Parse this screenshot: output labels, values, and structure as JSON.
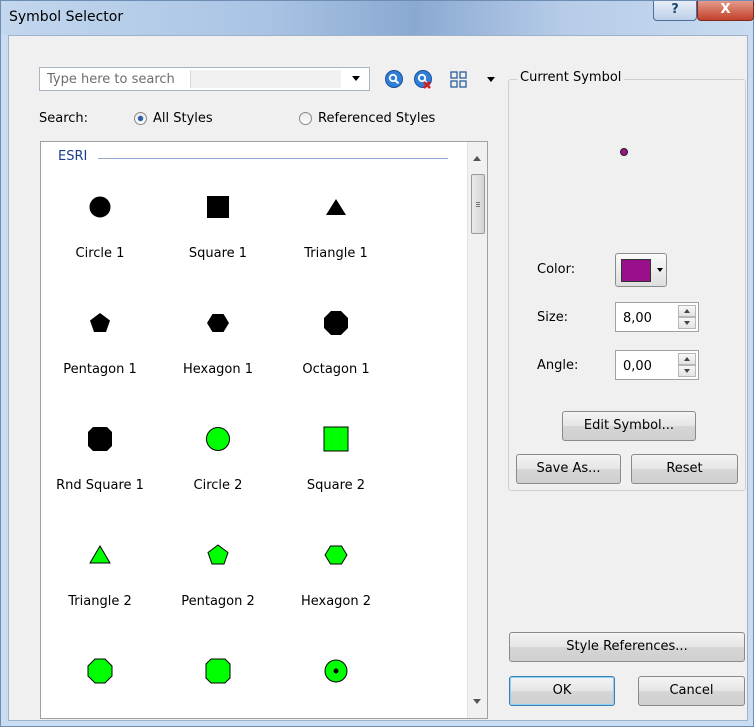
{
  "window": {
    "title": "Symbol Selector",
    "help_label": "?",
    "close_label": "X"
  },
  "search": {
    "placeholder": "Type here to search",
    "label": "Search:",
    "options": [
      "All Styles",
      "Referenced Styles"
    ],
    "selected": "All Styles"
  },
  "list": {
    "group": "ESRI",
    "items": [
      {
        "name": "Circle 1",
        "icon": "circle-icon",
        "fill": "#000000"
      },
      {
        "name": "Square 1",
        "icon": "square-icon",
        "fill": "#000000"
      },
      {
        "name": "Triangle 1",
        "icon": "triangle-icon",
        "fill": "#000000"
      },
      {
        "name": "Pentagon 1",
        "icon": "pentagon-icon",
        "fill": "#000000"
      },
      {
        "name": "Hexagon 1",
        "icon": "hexagon-icon",
        "fill": "#000000"
      },
      {
        "name": "Octagon 1",
        "icon": "octagon-icon",
        "fill": "#000000"
      },
      {
        "name": "Rnd Square 1",
        "icon": "rounded-square-icon",
        "fill": "#000000"
      },
      {
        "name": "Circle 2",
        "icon": "circle-icon",
        "fill": "#00ff00"
      },
      {
        "name": "Square 2",
        "icon": "square-icon",
        "fill": "#00ff00"
      },
      {
        "name": "Triangle 2",
        "icon": "triangle-icon",
        "fill": "#00ff00"
      },
      {
        "name": "Pentagon 2",
        "icon": "pentagon-icon",
        "fill": "#00ff00"
      },
      {
        "name": "Hexagon 2",
        "icon": "hexagon-icon",
        "fill": "#00ff00"
      },
      {
        "name": "",
        "icon": "octagon-icon",
        "fill": "#00ff00"
      },
      {
        "name": "",
        "icon": "rounded-square-icon",
        "fill": "#00ff00"
      },
      {
        "name": "",
        "icon": "circle-dot-icon",
        "fill": "#00ff00"
      }
    ]
  },
  "current_symbol": {
    "title": "Current Symbol",
    "color_label": "Color:",
    "color": "#9a0f8a",
    "size_label": "Size:",
    "size_value": "8,00",
    "angle_label": "Angle:",
    "angle_value": "0,00",
    "edit_label": "Edit Symbol...",
    "save_as_label": "Save As...",
    "reset_label": "Reset"
  },
  "footer": {
    "style_references_label": "Style References...",
    "ok_label": "OK",
    "cancel_label": "Cancel"
  }
}
